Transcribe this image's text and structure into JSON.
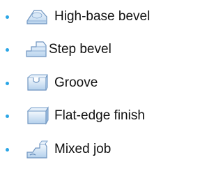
{
  "list": {
    "items": [
      {
        "label": "High-base bevel",
        "icon": "high-base-bevel-icon"
      },
      {
        "label": "Step bevel",
        "icon": "step-bevel-icon"
      },
      {
        "label": "Groove",
        "icon": "groove-icon"
      },
      {
        "label": "Flat-edge finish",
        "icon": "flat-edge-finish-icon"
      },
      {
        "label": "Mixed job",
        "icon": "mixed-job-icon"
      }
    ]
  },
  "colors": {
    "bullet": "#2aa6e6",
    "icon_light": "#eaf3fb",
    "icon_mid": "#a9c8e6",
    "icon_dark": "#5f87b5"
  }
}
